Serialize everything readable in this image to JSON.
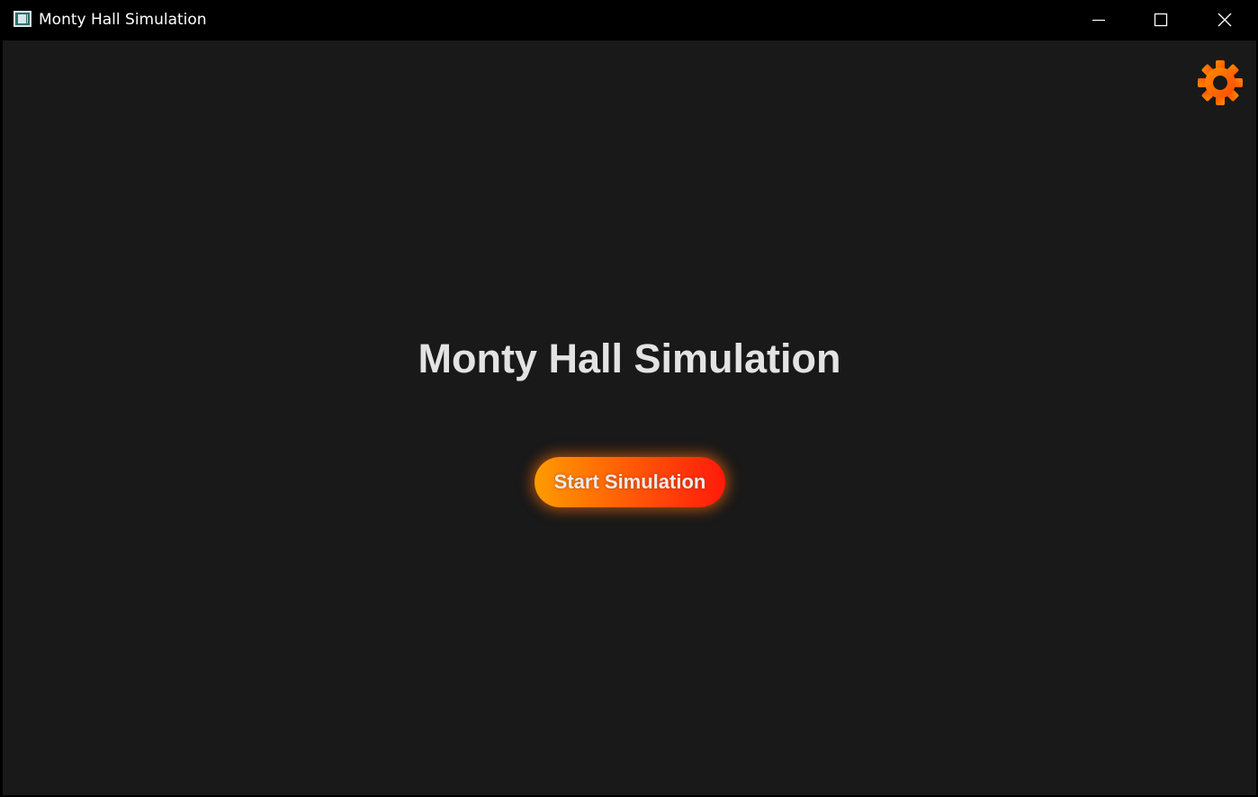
{
  "window": {
    "title": "Monty Hall Simulation",
    "app_icon": "app-window-icon",
    "controls": {
      "minimize_icon": "minimize-icon",
      "maximize_icon": "maximize-icon",
      "close_icon": "close-icon"
    }
  },
  "main": {
    "heading": "Monty Hall Simulation",
    "start_button_label": "Start Simulation",
    "settings_icon": "gear-icon"
  },
  "colors": {
    "background": "#191919",
    "titlebar": "#000000",
    "heading_text": "#e3e3e3",
    "accent_start": "#ff9b00",
    "accent_end": "#ff1a0a",
    "gear_orange": "#ff6a00"
  }
}
